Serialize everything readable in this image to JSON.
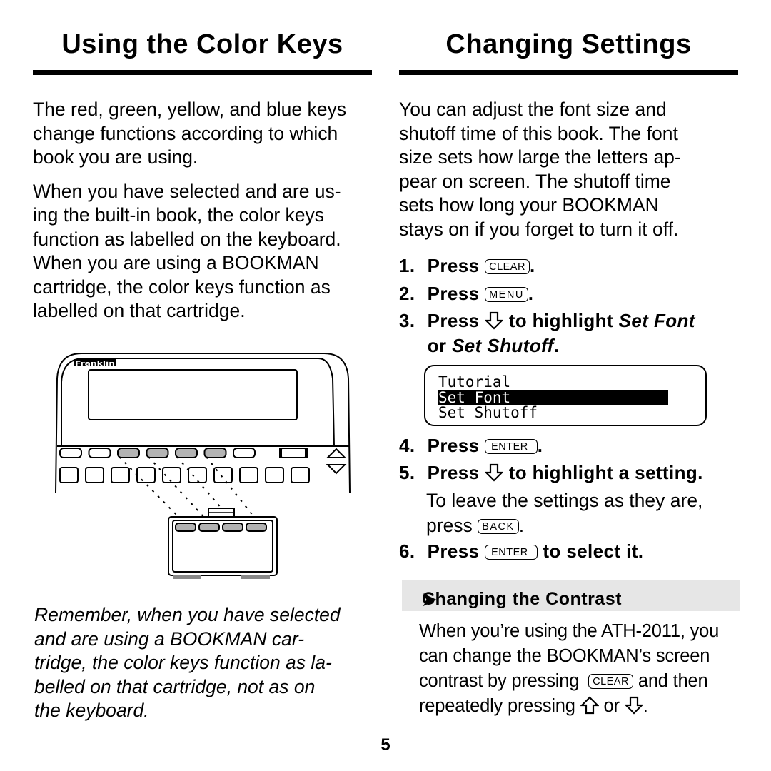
{
  "left": {
    "title": "Using the Color Keys",
    "para1": "The red, green, yellow, and blue keys\nchange functions according to which\nbook you are using.",
    "para2": "When you have selected and are us-\ning the built-in book, the color keys\nfunction as labelled on the keyboard.\nWhen you are using a BOOKMAN\ncartridge, the color keys function as\nlabelled on that cartridge.",
    "illustration": {
      "brand_logo": "Franklin",
      "top_row_keys": 7,
      "color_keys_highlighted": 4,
      "bottom_row_keys": 10,
      "cartridge_color_keys": 4
    },
    "note": "Remember, when you have selected\nand are using a BOOKMAN car-\ntridge, the color keys function as la-\nbelled on that cartridge, not as on\nthe keyboard."
  },
  "right": {
    "title": "Changing Settings",
    "intro": "You can adjust the font size and\nshutoff time of this book. The font\nsize sets how large the letters ap-\npear on screen. The shutoff time\nsets how long your BOOKMAN\nstays on if you forget to turn it off.",
    "steps": [
      {
        "num": "1.",
        "word": "Press",
        "key": "CLEAR",
        "after": "."
      },
      {
        "num": "2.",
        "word": "Press",
        "key": "MENU",
        "after": "."
      },
      {
        "num": "3.",
        "word": "Press",
        "icon": "down-arrow",
        "text": "to highlight",
        "italic1": "Set Font",
        "line2_pre": "or",
        "italic2": "Set Shutoff",
        "after": "."
      },
      {
        "num": "4.",
        "word": "Press",
        "key": "ENTER",
        "after": "."
      },
      {
        "num": "5.",
        "word": "Press",
        "icon": "down-arrow",
        "text": "to highlight a setting.",
        "detail_pre": "To leave the settings as they are,",
        "detail_word": "press",
        "detail_key": "BACK",
        "detail_after": "."
      },
      {
        "num": "6.",
        "word": "Press",
        "key": "ENTER",
        "text": "to select it."
      }
    ],
    "screen_menu": {
      "items": [
        "Tutorial",
        "Set Font",
        "Set Shutoff"
      ],
      "selected_index": 1
    },
    "subsection": {
      "marker": "➤",
      "title": "Changing the Contrast",
      "line1": "When you’re using the ATH-2011, you",
      "line2": "can change the BOOKMAN’s screen",
      "line3_pre": "contrast by pressing",
      "line3_key": "CLEAR",
      "line3_post": "and then",
      "line4_pre": "repeatedly pressing",
      "line4_mid": "or",
      "line4_post": "."
    }
  },
  "page_number": "5"
}
